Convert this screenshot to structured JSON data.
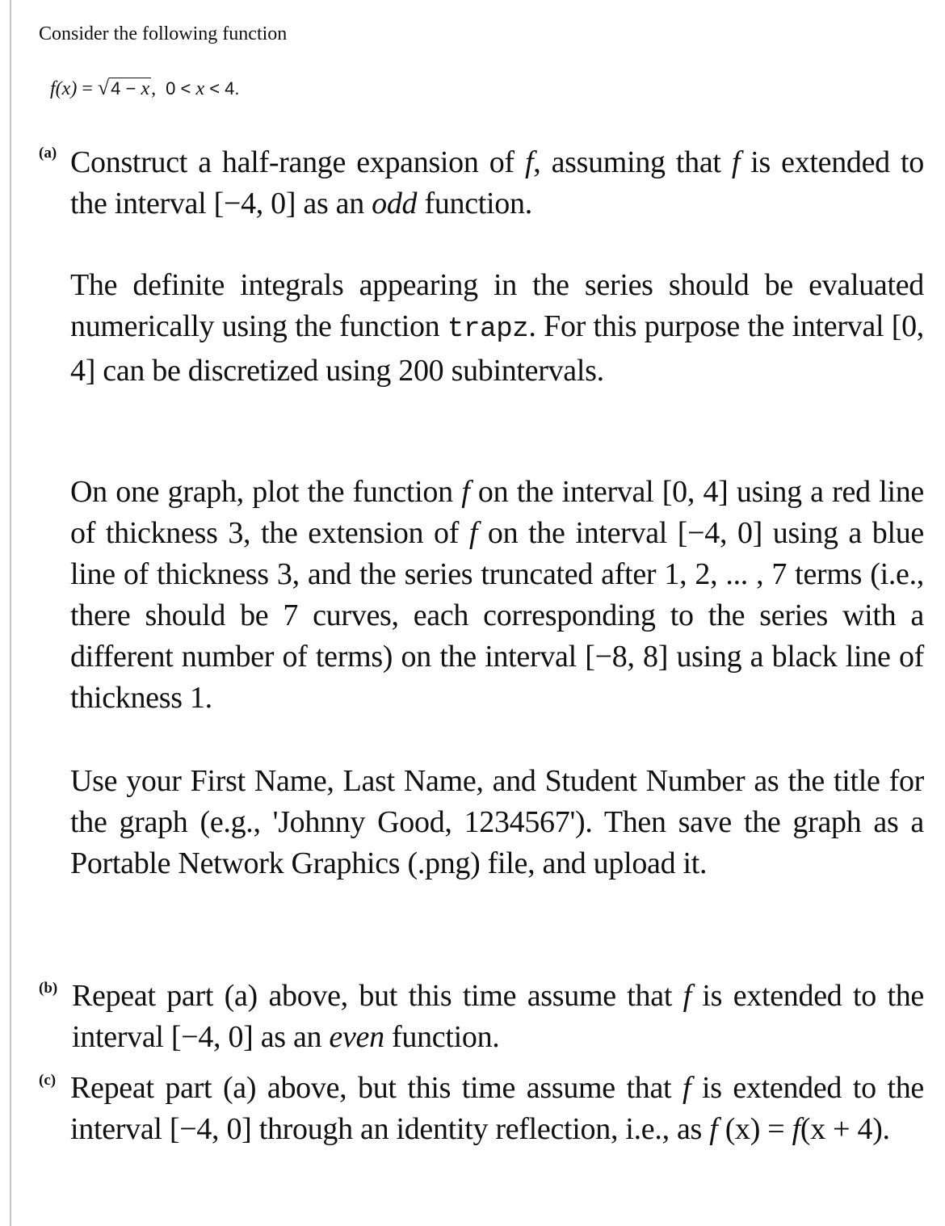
{
  "intro": "Consider the following function",
  "equation": {
    "lhs": "f(x)",
    "equals": "=",
    "sqrt_symbol": "√",
    "radicand_const": "4 − ",
    "radicand_var": "x",
    "separator": ",",
    "condition_lower": "0 <",
    "condition_var": "x",
    "condition_upper": "< 4."
  },
  "parts": {
    "a": {
      "label": "(a)",
      "p1_s1": "Construct a half-range expansion of ",
      "p1_f1": "f",
      "p1_s2": ", assuming that ",
      "p1_f2": "f",
      "p1_s3": " is extended to the interval [−4, 0] as an ",
      "p1_em": "odd",
      "p1_s4": " function.",
      "p2_s1": "The definite integrals appearing in the series should be evaluated numerically using the function ",
      "p2_code": "trapz",
      "p2_s2": ". For this purpose the interval [0, 4] can be discretized using 200 subintervals.",
      "p3_s1": "On one graph, plot the function ",
      "p3_f1": "f",
      "p3_s2": " on the interval [0, 4] using a red line of thickness 3, the extension of ",
      "p3_f2": "f",
      "p3_s3": " on the interval [−4, 0] using a blue line of thickness 3, and the series truncated after 1, 2, ... , 7 terms (i.e., there should be 7 curves, each corresponding to the series with a different number of terms) on the interval [−8, 8] using a black line of thickness 1.",
      "p4": "Use your First Name, Last Name, and Student Number as the title for the graph (e.g., 'Johnny Good, 1234567'). Then save the graph as a Portable Network Graphics (.png) file, and upload it."
    },
    "b": {
      "label": "(b)",
      "s1": "Repeat part (a) above, but this time assume that ",
      "f1": "f",
      "s2": " is extended to the interval [−4, 0] as an ",
      "em": "even",
      "s3": " function."
    },
    "c": {
      "label": "(c)",
      "s1": "Repeat part (a) above, but this time assume that ",
      "f1": "f",
      "s2": " is extended to the interval [−4, 0] through an identity reflection, i.e., as ",
      "f2": "f",
      "s3": " (x) = ",
      "f3": "f",
      "s4": "(x + 4)."
    }
  }
}
